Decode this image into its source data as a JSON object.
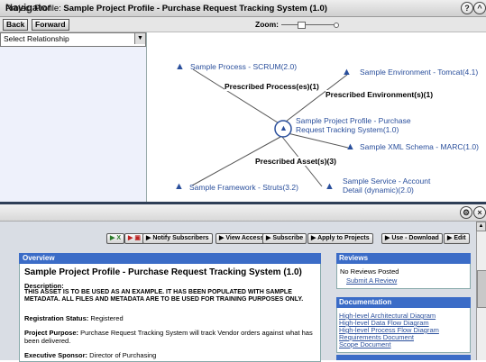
{
  "navigator": {
    "title": "Navigator",
    "help_icon": "?",
    "collapse_icon": "^",
    "back_label": "Back",
    "forward_label": "Forward",
    "zoom_label": "Zoom:",
    "select_relationship": "Select Relationship",
    "graph": {
      "center": "Sample Project Profile - Purchase Request Tracking System(1.0)",
      "nodes": [
        "Sample Process - SCRUM(2.0)",
        "Sample Environment - Tomcat(4.1)",
        "Sample XML Schema - MARC(1.0)",
        "Sample Service - Account Detail (dynamic)(2.0)",
        "Sample Framework - Struts(3.2)"
      ],
      "edges": [
        "Prescribed Process(es)(1)",
        "Prescribed Environment(s)(1)",
        "Prescribed Asset(s)(3)"
      ]
    }
  },
  "profile": {
    "label": "Project Profile:",
    "name": "Sample Project Profile - Purchase Request Tracking System (1.0)",
    "actions": [
      "Notify Subscribers",
      "View Access",
      "Subscribe",
      "Apply to Projects",
      "Use - Download",
      "Edit"
    ],
    "overview": {
      "header": "Overview",
      "title": "Sample Project Profile - Purchase Request Tracking System (1.0)",
      "description_label": "Description:",
      "description": "THIS ASSET IS TO BE USED AS AN EXAMPLE. IT HAS BEEN POPULATED WITH SAMPLE METADATA. ALL FILES AND METADATA ARE TO BE USED FOR TRAINING PURPOSES ONLY.",
      "registration_label": "Registration Status:",
      "registration_value": "Registered",
      "purpose_label": "Project Purpose:",
      "purpose_value": "Purchase Request Tracking System will track Vendor orders against what has been delivered.",
      "sponsor_label": "Executive Sponsor:",
      "sponsor_value": "Director of Purchasing"
    },
    "reviews": {
      "header": "Reviews",
      "status": "No Reviews Posted",
      "link": "Submit A Review"
    },
    "documentation": {
      "header": "Documentation",
      "links": [
        "High-level Architectural Diagram",
        "High-level Data Flow Diagram",
        "High-level Process Flow Diagram",
        "Requirements Document",
        "Scope Document"
      ]
    }
  }
}
